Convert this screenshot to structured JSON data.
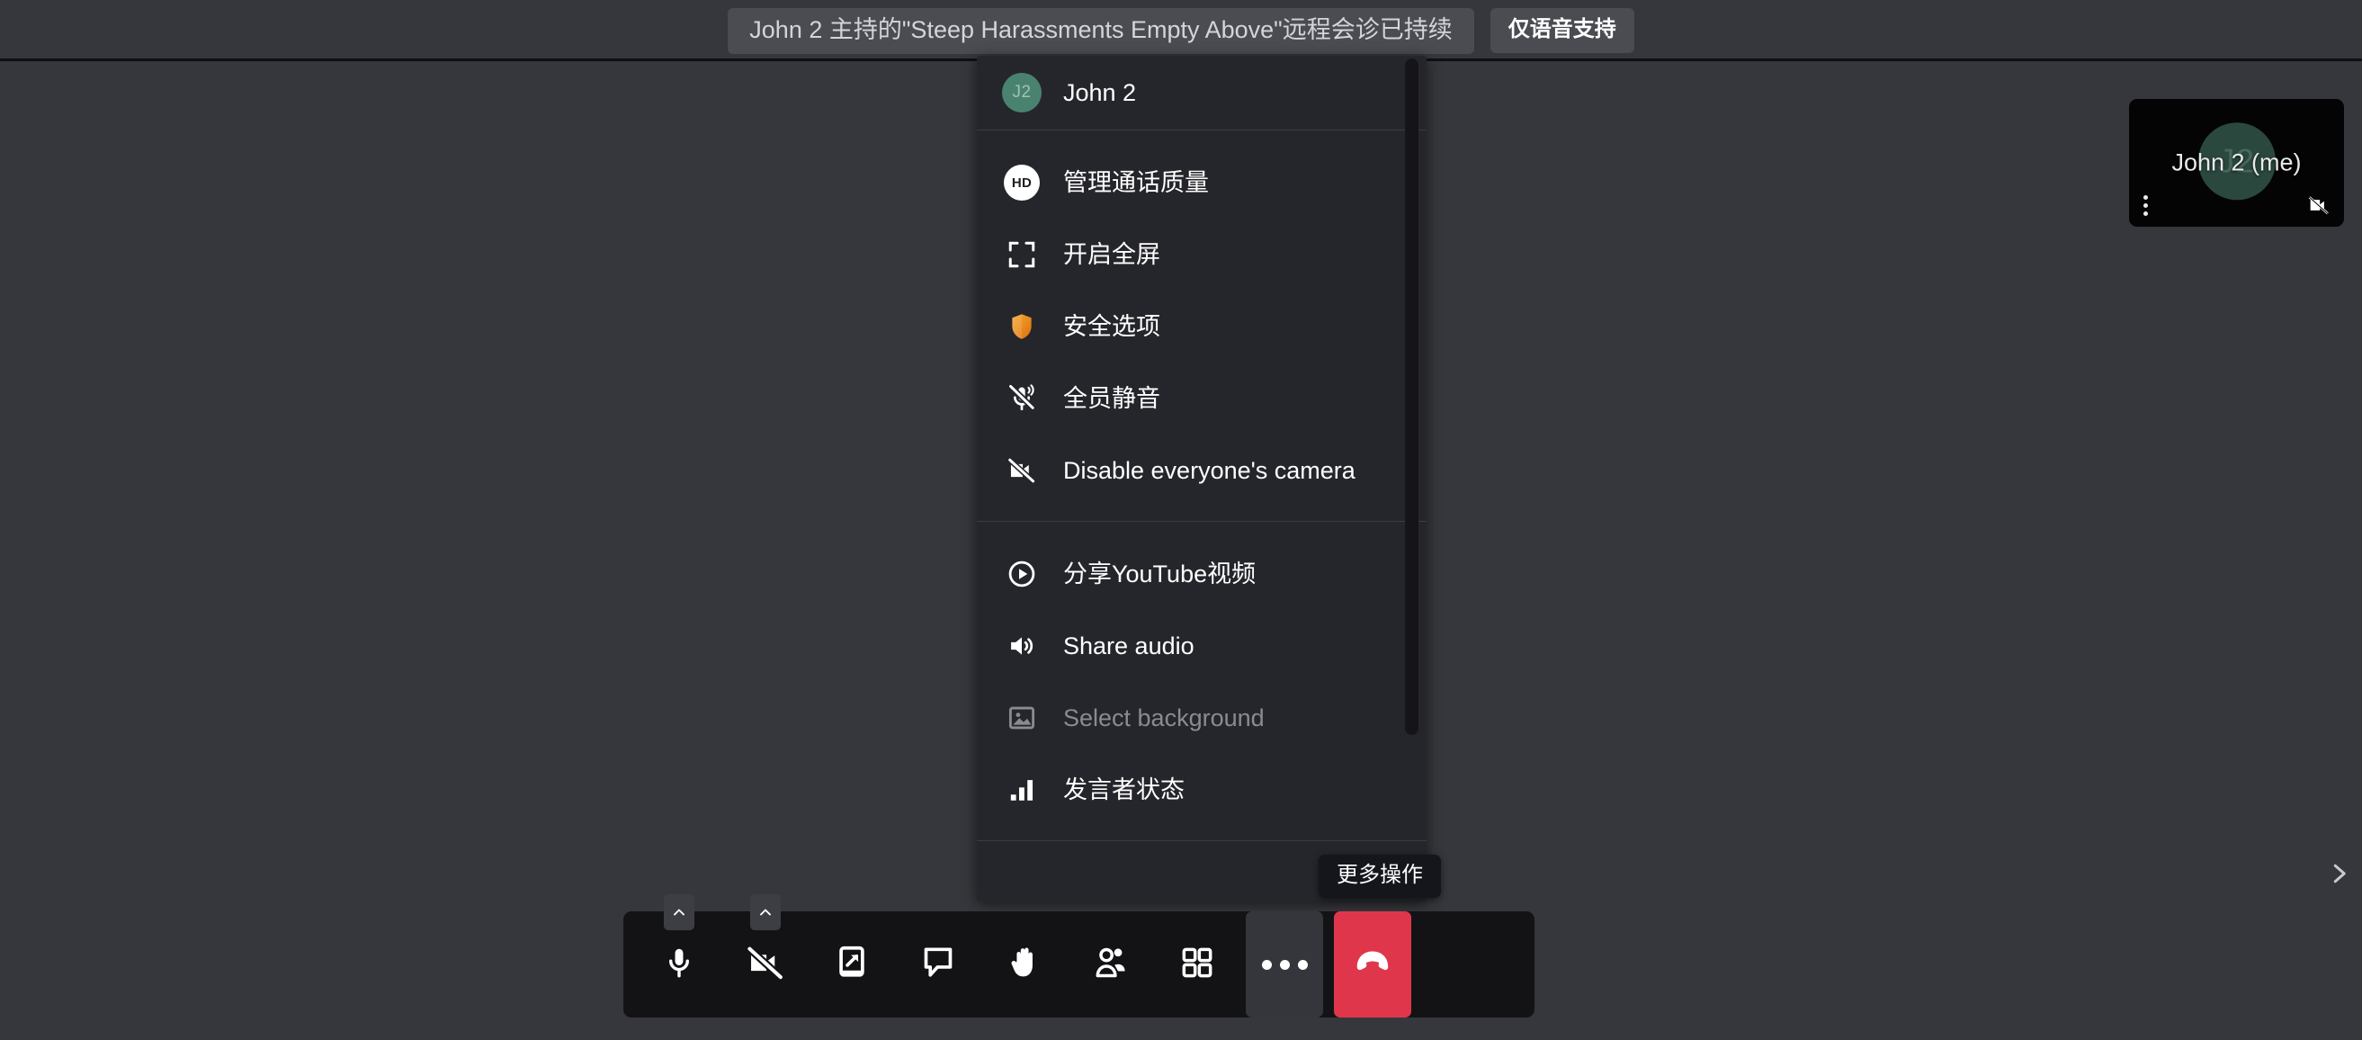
{
  "header": {
    "subject_pill": "John 2 主持的\"Steep Harassments Empty Above\"远程会诊已持续",
    "audio_only_pill": "仅语音支持"
  },
  "self_thumbnail": {
    "name": "John 2 (me)",
    "avatar_initials": "J2",
    "kebab_icon": "more-vertical-icon",
    "camera_off_icon": "camera-off-icon"
  },
  "side_chevron": {
    "icon": "chevron-right-icon"
  },
  "menu": {
    "profile": {
      "name": "John 2",
      "avatar_initials": "J2",
      "avatar_color": "#4a8270"
    },
    "items": [
      {
        "label": "管理通话质量",
        "icon": "hd-quality-icon",
        "disabled": false
      },
      {
        "label": "开启全屏",
        "icon": "fullscreen-icon",
        "disabled": false
      },
      {
        "label": "安全选项",
        "icon": "shield-icon",
        "disabled": false
      },
      {
        "label": "全员静音",
        "icon": "mute-everyone-icon",
        "disabled": false
      },
      {
        "label": "Disable everyone's camera",
        "icon": "disable-camera-everyone-icon",
        "disabled": false
      },
      {
        "label": "分享YouTube视频",
        "icon": "play-circle-icon",
        "disabled": false
      },
      {
        "label": "Share audio",
        "icon": "speaker-icon",
        "disabled": false
      },
      {
        "label": "Select background",
        "icon": "image-icon",
        "disabled": true
      },
      {
        "label": "发言者状态",
        "icon": "bar-chart-icon",
        "disabled": false
      }
    ],
    "hd_badge_text": "HD",
    "shield_color": "#e8871e"
  },
  "tooltip": {
    "text": "更多操作"
  },
  "toolbar": {
    "buttons": [
      {
        "name": "microphone",
        "icon": "microphone-icon",
        "has_chevron": true
      },
      {
        "name": "camera",
        "icon": "camera-off-icon",
        "has_chevron": true
      },
      {
        "name": "share-screen",
        "icon": "screen-share-icon",
        "has_chevron": false
      },
      {
        "name": "chat",
        "icon": "chat-bubble-icon",
        "has_chevron": false
      },
      {
        "name": "raise-hand",
        "icon": "raise-hand-icon",
        "has_chevron": false
      },
      {
        "name": "participants",
        "icon": "participants-icon",
        "has_chevron": false
      },
      {
        "name": "tile-view",
        "icon": "tile-view-icon",
        "has_chevron": false
      },
      {
        "name": "more-actions",
        "icon": "more-horizontal-icon",
        "has_chevron": false
      },
      {
        "name": "hangup",
        "icon": "hangup-icon",
        "has_chevron": false
      }
    ],
    "hangup_color": "#e0364b"
  },
  "colors": {
    "page_background": "#36373c",
    "menu_background": "#25262b",
    "toolbar_background": "#131316",
    "tooltip_background": "#14161c",
    "pill_background": "#4b4c52"
  }
}
